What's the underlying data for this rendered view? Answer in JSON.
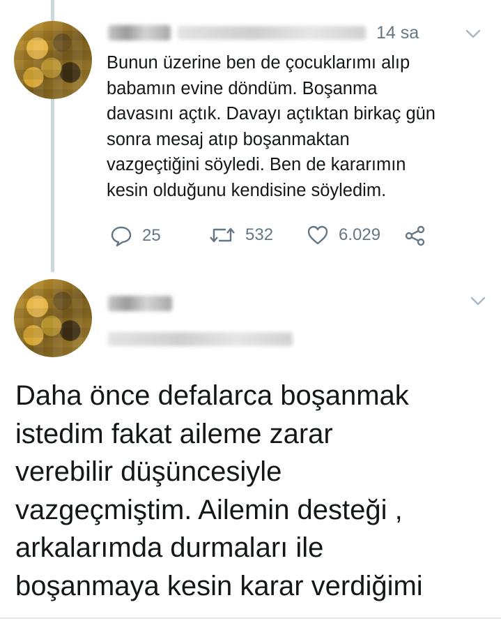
{
  "tweet1": {
    "time": "14 sa",
    "lines": [
      "Bunun üzerine ben de çocuklarımı alıp",
      "babamın evine döndüm. Boşanma",
      "davasını açtık. Davayı açtıktan birkaç gün",
      "sonra mesaj atıp boşanmaktan",
      "vazgeçtiğini söyledi. Ben de kararımın",
      "kesin olduğunu kendisine söyledim."
    ],
    "actions": {
      "replies": "25",
      "retweets": "532",
      "likes": "6.029"
    }
  },
  "tweet2": {
    "lines": [
      "Daha önce defalarca boşanmak",
      "istedim fakat aileme zarar",
      "verebilir düşüncesiyle",
      "vazgeçmiştim. Ailemin desteği ,",
      "arkalarımda durmaları ile",
      "boşanmaya kesin karar verdiğimi"
    ]
  },
  "colors": {
    "text": "#14171a",
    "secondary": "#657786",
    "thread_line": "#ccd6dd"
  }
}
